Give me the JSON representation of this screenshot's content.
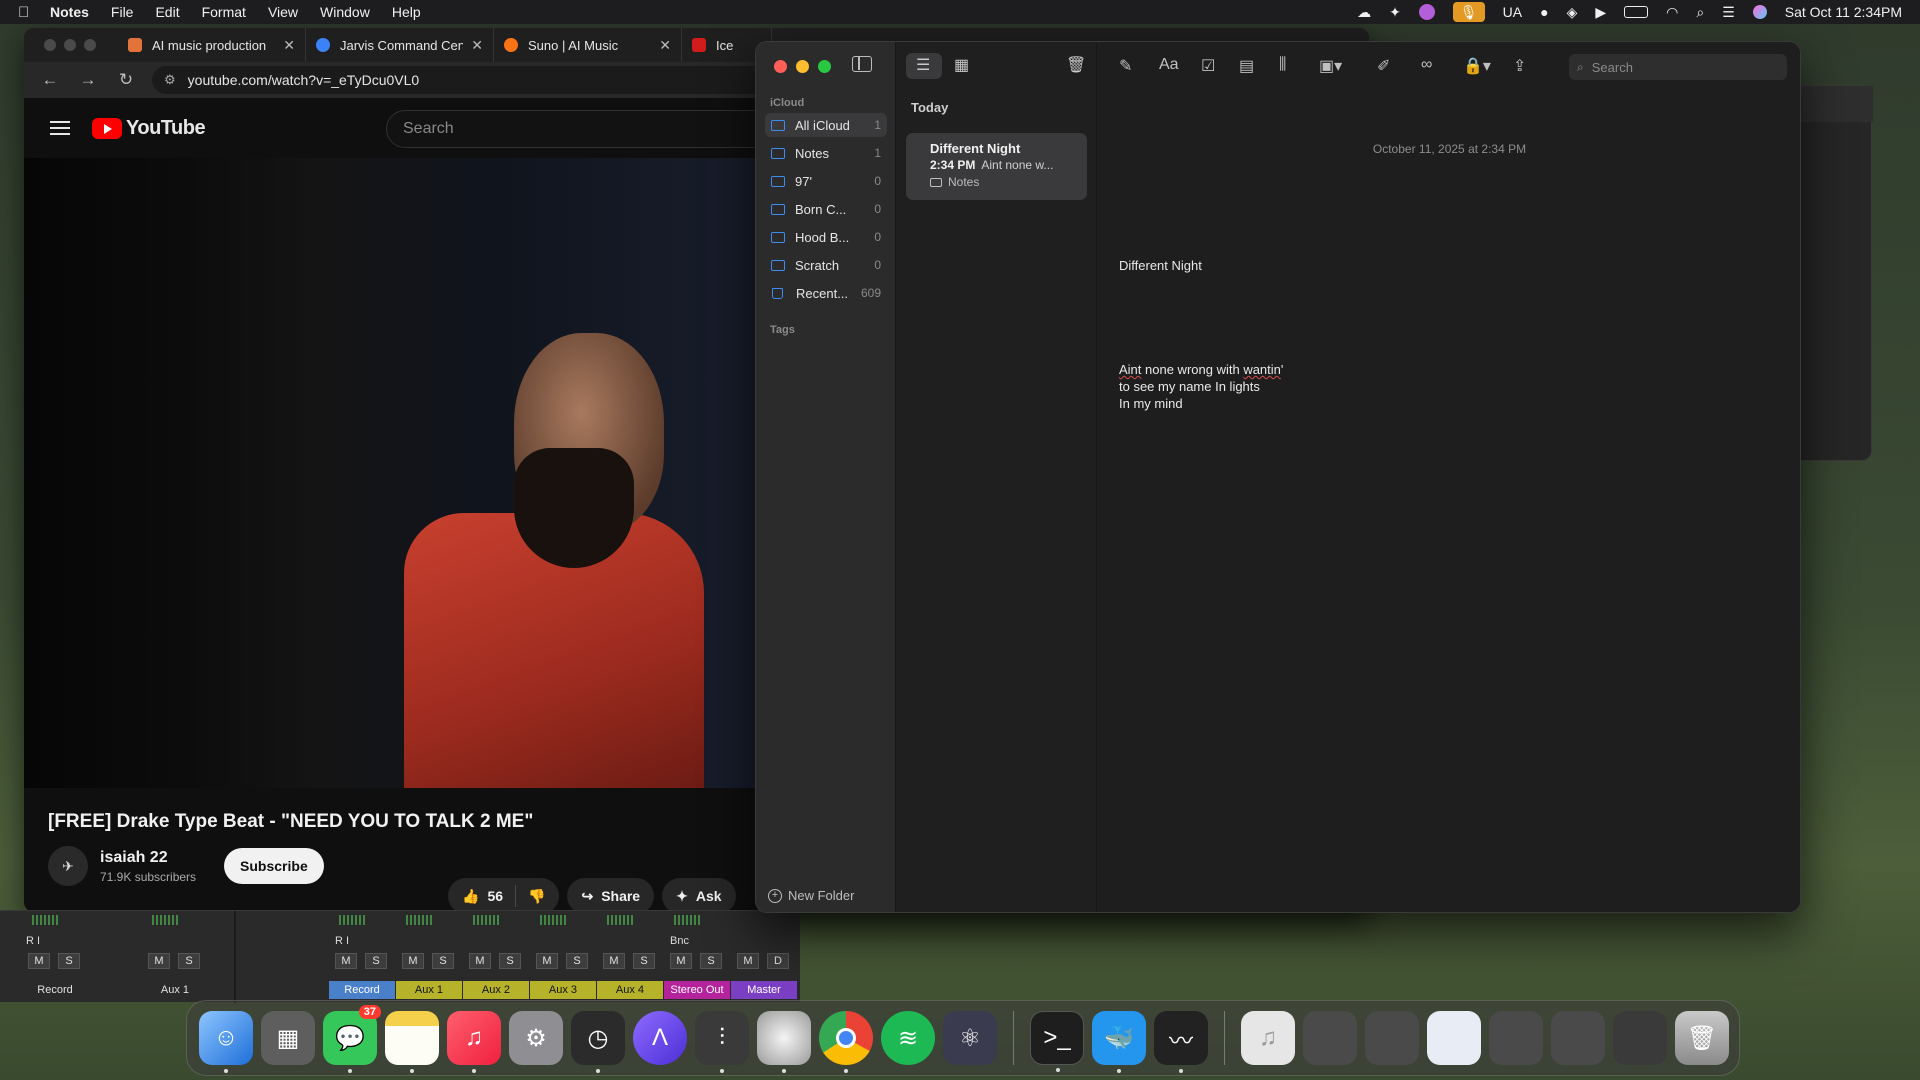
{
  "menubar": {
    "app": "Notes",
    "items": [
      "File",
      "Edit",
      "Format",
      "View",
      "Window",
      "Help"
    ],
    "status": {
      "input_source": "UA",
      "datetime": "Sat Oct 11  2:34PM"
    }
  },
  "browser": {
    "tabs": [
      {
        "title": "AI music production",
        "favicon_color": "#e2733b"
      },
      {
        "title": "Jarvis Command Cen",
        "favicon_color": "#3b82f6"
      },
      {
        "title": "Suno | AI Music",
        "favicon_color": "#f97316"
      },
      {
        "title": "Ice",
        "favicon_color": "#d11c1c"
      }
    ],
    "url": "youtube.com/watch?v=_eTyDcu0VL0",
    "youtube": {
      "search_placeholder": "Search",
      "logo_text": "YouTube",
      "video_title": "[FREE] Drake Type Beat - \"NEED YOU TO TALK 2 ME\"",
      "channel_name": "isaiah 22",
      "subscribers": "71.9K subscribers",
      "subscribe_label": "Subscribe",
      "likes": "56",
      "share_label": "Share",
      "ask_label": "Ask"
    }
  },
  "daw": {
    "channels": [
      {
        "name": "Record",
        "color": "#2a2a2a",
        "text_color": "#e0e0e0",
        "buttons": [
          "M",
          "S"
        ]
      },
      {
        "name": "Aux 1",
        "color": "#2a2a2a",
        "text_color": "#e0e0e0",
        "buttons": [
          "M",
          "S"
        ]
      },
      {
        "name": "Record",
        "color": "#4a7fc9",
        "text_color": "#ffffff",
        "buttons": [
          "M",
          "S"
        ]
      },
      {
        "name": "Aux 1",
        "color": "#b6b32a",
        "text_color": "#111111",
        "buttons": [
          "M",
          "S"
        ]
      },
      {
        "name": "Aux 2",
        "color": "#b6b32a",
        "text_color": "#111111",
        "buttons": [
          "M",
          "S"
        ]
      },
      {
        "name": "Aux 3",
        "color": "#b6b32a",
        "text_color": "#111111",
        "buttons": [
          "M",
          "S"
        ]
      },
      {
        "name": "Aux 4",
        "color": "#b6b32a",
        "text_color": "#111111",
        "buttons": [
          "M",
          "S"
        ]
      },
      {
        "name": "Stereo Out",
        "color": "#b5239c",
        "text_color": "#ffffff",
        "buttons": [
          "M",
          "S"
        ]
      },
      {
        "name": "Master",
        "color": "#7b3fc4",
        "text_color": "#ffffff",
        "buttons": [
          "M",
          "D"
        ]
      }
    ],
    "extras": {
      "ri": "R  I",
      "bnc": "Bnc"
    }
  },
  "notes": {
    "sidebar": {
      "section_icloud": "iCloud",
      "folders": [
        {
          "name": "All iCloud",
          "count": "1"
        },
        {
          "name": "Notes",
          "count": "1"
        },
        {
          "name": "97'",
          "count": "0"
        },
        {
          "name": "Born C...",
          "count": "0"
        },
        {
          "name": "Hood B...",
          "count": "0"
        },
        {
          "name": "Scratch",
          "count": "0"
        },
        {
          "name": "Recent...",
          "count": "609"
        }
      ],
      "section_tags": "Tags",
      "new_folder_label": "New Folder"
    },
    "list": {
      "header": "Today",
      "note": {
        "title": "Different Night",
        "time": "2:34 PM",
        "preview": "Aint none w...",
        "folder": "Notes"
      }
    },
    "editor": {
      "search_placeholder": "Search",
      "date": "October 11, 2025 at 2:34 PM",
      "title": "Different Night",
      "body": {
        "line1_a": "Aint",
        "line1_b": " none wrong with ",
        "line1_c": "wantin",
        "line1_d": "'",
        "line2": "to see my name In lights",
        "line3": "In my mind"
      }
    }
  },
  "dock": {
    "messages_badge": "37",
    "apps": [
      {
        "icon": "finder-icon",
        "color": "#3a8ee6"
      },
      {
        "icon": "launchpad-icon",
        "color": "#6b6b6b"
      },
      {
        "icon": "messages-icon",
        "color": "#35c759"
      },
      {
        "icon": "notes-icon",
        "color": "#f5d04a"
      },
      {
        "icon": "music-icon",
        "color": "#fa3c4c"
      },
      {
        "icon": "system-settings-icon",
        "color": "#8e8e93"
      },
      {
        "icon": "logic-icon",
        "color": "#2b2b2b"
      },
      {
        "icon": "avid-icon",
        "color": "#6b4df0"
      },
      {
        "icon": "mixer-icon",
        "color": "#3a3a3a"
      },
      {
        "icon": "logic-pro-icon",
        "color": "#d8d8d8"
      },
      {
        "icon": "chrome-icon",
        "color": "#ffffff"
      },
      {
        "icon": "spotify-icon",
        "color": "#1db954"
      },
      {
        "icon": "electron-icon",
        "color": "#3b3b4f"
      },
      {
        "icon": "terminal-icon",
        "color": "#1e1e1e"
      },
      {
        "icon": "docker-icon",
        "color": "#2496ed"
      },
      {
        "icon": "audio-app-icon",
        "color": "#222222"
      },
      {
        "icon": "music-file-icon",
        "color": "#e6e6e6"
      },
      {
        "icon": "window-thumb-icon",
        "color": "#4a4a4a"
      },
      {
        "icon": "window-thumb-icon",
        "color": "#4a4a4a"
      },
      {
        "icon": "window-thumb-icon",
        "color": "#e8ecf5"
      },
      {
        "icon": "window-thumb-icon",
        "color": "#4a4a4a"
      },
      {
        "icon": "window-thumb-icon",
        "color": "#4a4a4a"
      },
      {
        "icon": "window-thumb-icon",
        "color": "#3a3a3a"
      },
      {
        "icon": "trash-icon",
        "color": "#9a9a9a"
      }
    ]
  }
}
